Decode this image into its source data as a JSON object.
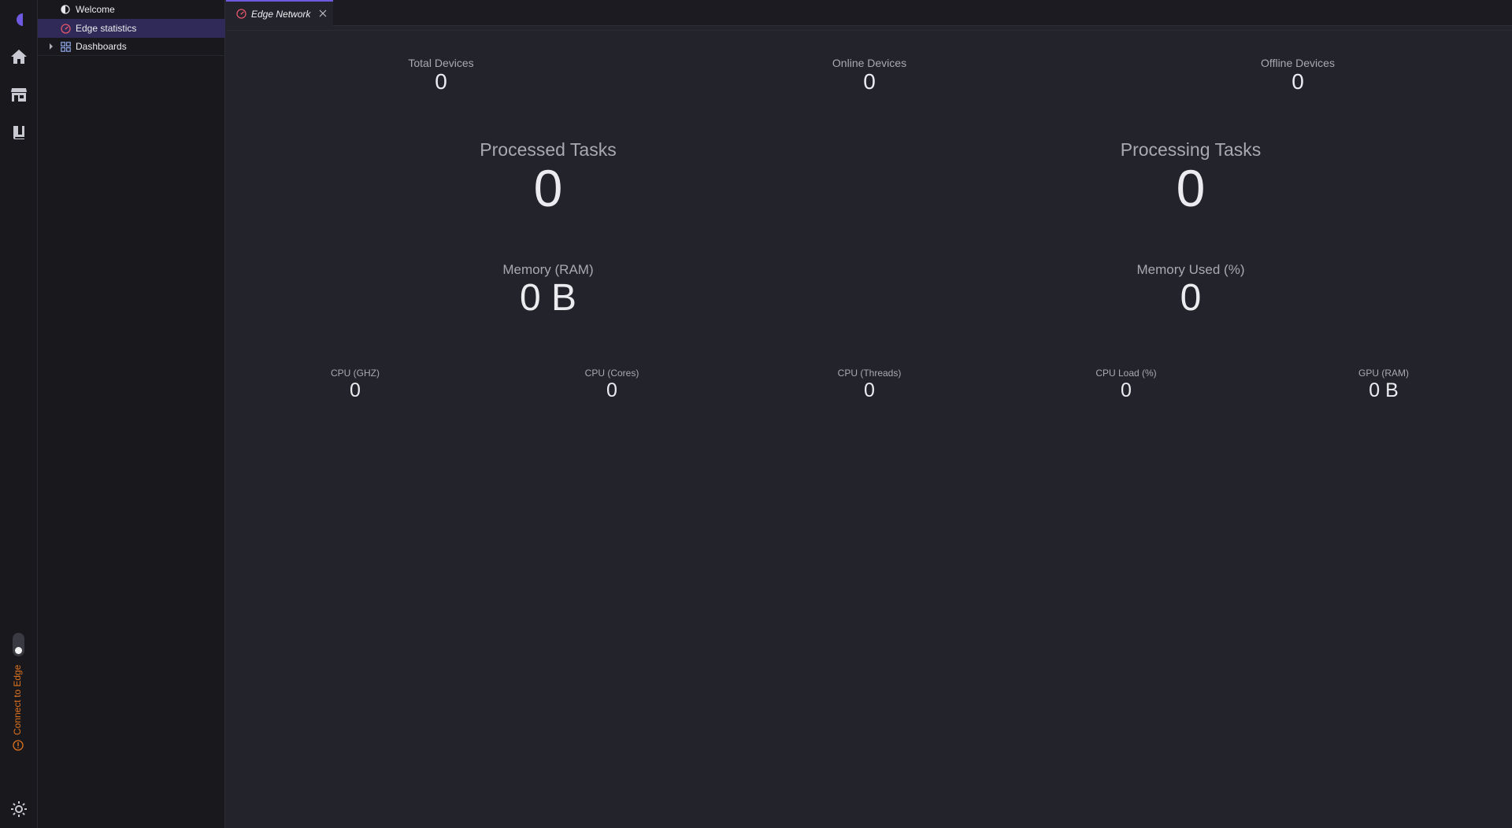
{
  "sidebar": {
    "items": [
      {
        "label": "Welcome",
        "icon": "half-moon-icon"
      },
      {
        "label": "Edge statistics",
        "icon": "speedometer-icon",
        "selected": true
      },
      {
        "label": "Dashboards",
        "icon": "grid-icon",
        "expandable": true
      }
    ]
  },
  "activity_bar": {
    "icons": [
      "logo-icon",
      "home-icon",
      "store-icon",
      "book-icon",
      "gear-icon"
    ],
    "connect_label": "Connect to Edge"
  },
  "editor": {
    "tab": {
      "label": "Edge Network",
      "icon": "speedometer-icon"
    }
  },
  "stats": {
    "total_devices": {
      "label": "Total Devices",
      "value": "0"
    },
    "online_devices": {
      "label": "Online Devices",
      "value": "0"
    },
    "offline_devices": {
      "label": "Offline Devices",
      "value": "0"
    },
    "processed_tasks": {
      "label": "Processed Tasks",
      "value": "0"
    },
    "processing_tasks": {
      "label": "Processing Tasks",
      "value": "0"
    },
    "memory_ram": {
      "label": "Memory (RAM)",
      "value": "0 B"
    },
    "memory_used": {
      "label": "Memory Used (%)",
      "value": "0"
    },
    "cpu_ghz": {
      "label": "CPU (GHZ)",
      "value": "0"
    },
    "cpu_cores": {
      "label": "CPU (Cores)",
      "value": "0"
    },
    "cpu_threads": {
      "label": "CPU (Threads)",
      "value": "0"
    },
    "cpu_load": {
      "label": "CPU Load (%)",
      "value": "0"
    },
    "gpu_ram": {
      "label": "GPU (RAM)",
      "value": "0 B"
    }
  },
  "colors": {
    "accent": "#6d5ae0",
    "selected_bg": "#2f2a58",
    "warning": "#e0731f",
    "speedometer": "#e0556a"
  }
}
